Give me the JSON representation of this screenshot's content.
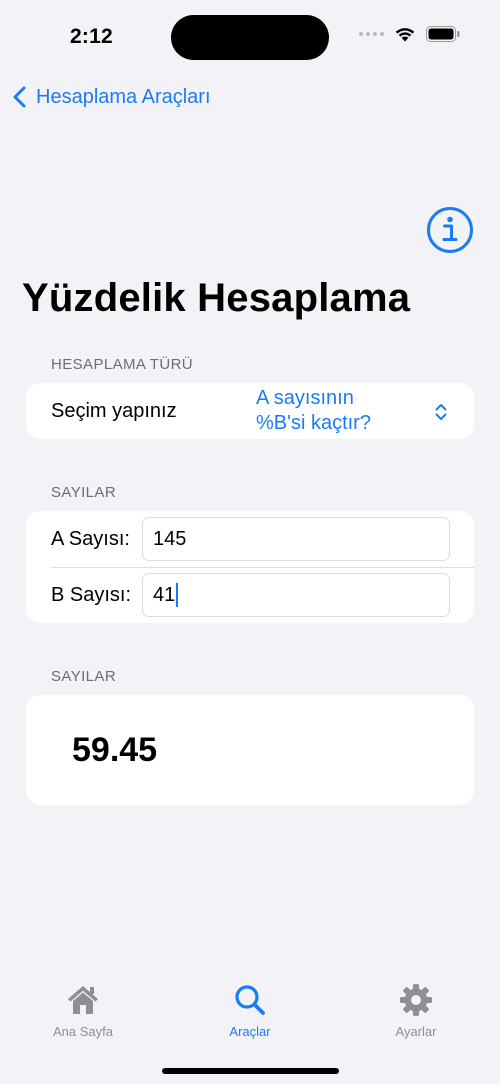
{
  "status_bar": {
    "time": "2:12"
  },
  "nav": {
    "back_label": "Hesaplama Araçları"
  },
  "page": {
    "title": "Yüzdelik Hesaplama"
  },
  "calc_type": {
    "header": "HESAPLAMA TÜRÜ",
    "label": "Seçim yapınız",
    "selected_line1": "A sayısının",
    "selected_line2": "%B'si kaçtır?"
  },
  "numbers": {
    "header": "SAYILAR",
    "a_label": "A Sayısı:",
    "a_value": "145",
    "b_label": "B Sayısı:",
    "b_value": "41"
  },
  "result": {
    "header": "SAYILAR",
    "value": "59.45"
  },
  "tabs": [
    {
      "label": "Ana Sayfa",
      "icon": "house-icon",
      "active": false
    },
    {
      "label": "Araçlar",
      "icon": "magnifier-icon",
      "active": true
    },
    {
      "label": "Ayarlar",
      "icon": "gear-icon",
      "active": false
    }
  ],
  "colors": {
    "accent": "#1a7cf5",
    "inactive": "#8e8e93",
    "background": "#f2f2f7"
  }
}
